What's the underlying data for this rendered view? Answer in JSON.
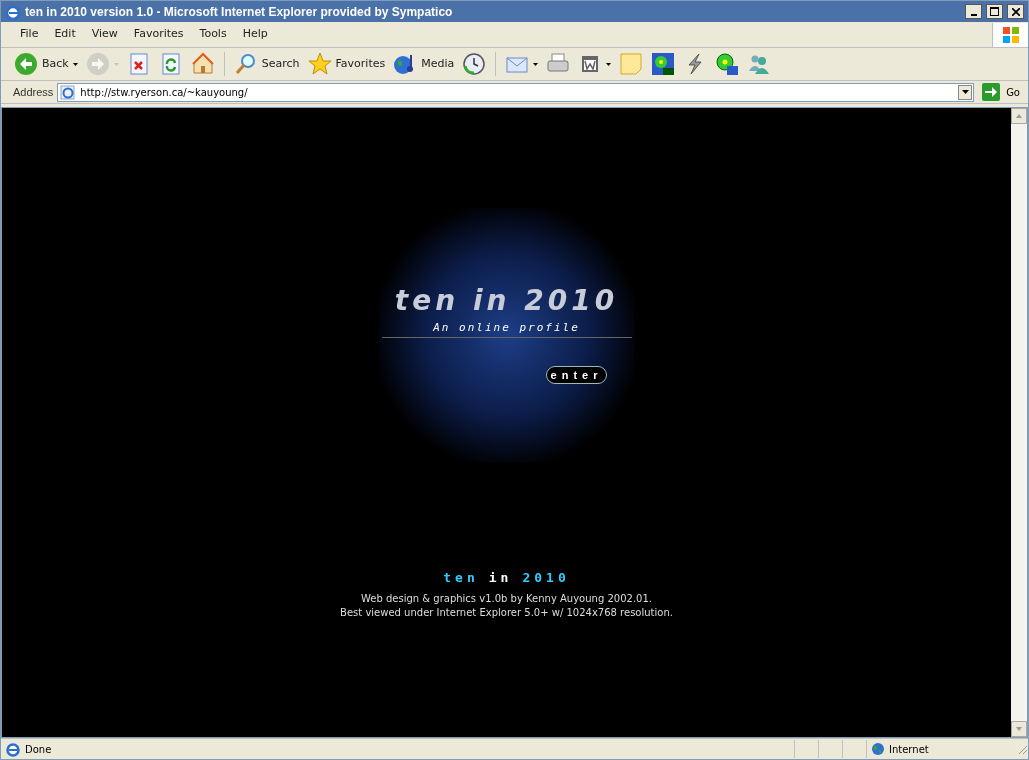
{
  "window": {
    "title": "ten in 2010 version 1.0 - Microsoft Internet Explorer provided by Sympatico"
  },
  "menu": [
    "File",
    "Edit",
    "View",
    "Favorites",
    "Tools",
    "Help"
  ],
  "toolbar": [
    {
      "kind": "back",
      "label": "Back",
      "dropdown": true,
      "disabled": false
    },
    {
      "kind": "forward",
      "dropdown": true,
      "disabled": true
    },
    {
      "kind": "stop",
      "dropdown": false,
      "disabled": false
    },
    {
      "kind": "refresh",
      "dropdown": false,
      "disabled": false
    },
    {
      "kind": "home",
      "dropdown": false,
      "disabled": false
    },
    {
      "kind": "separator"
    },
    {
      "kind": "search",
      "label": "Search",
      "dropdown": false,
      "disabled": false
    },
    {
      "kind": "favorites",
      "label": "Favorites",
      "dropdown": false,
      "disabled": false
    },
    {
      "kind": "media",
      "label": "Media",
      "dropdown": false,
      "disabled": false
    },
    {
      "kind": "history",
      "dropdown": false,
      "disabled": false
    },
    {
      "kind": "separator"
    },
    {
      "kind": "mail",
      "dropdown": true,
      "disabled": false
    },
    {
      "kind": "print",
      "dropdown": false,
      "disabled": false
    },
    {
      "kind": "edit",
      "dropdown": true,
      "disabled": false
    },
    {
      "kind": "note",
      "dropdown": false,
      "disabled": false
    },
    {
      "kind": "flower-pro",
      "dropdown": false,
      "disabled": false
    },
    {
      "kind": "lightning",
      "dropdown": false,
      "disabled": false
    },
    {
      "kind": "flower-lite",
      "dropdown": false,
      "disabled": false
    },
    {
      "kind": "people",
      "dropdown": false,
      "disabled": false
    }
  ],
  "address": {
    "label": "Address",
    "value": "http://stw.ryerson.ca/~kauyoung/",
    "go": "Go"
  },
  "splash": {
    "title": "ten in 2010",
    "subtitle": "An online profile",
    "enter": "enter"
  },
  "footer": {
    "title": [
      {
        "text": "ten",
        "color": "#33ccff"
      },
      {
        "text": "in",
        "color": "#ffffff"
      },
      {
        "text": "2010",
        "color": "#33ccff"
      }
    ],
    "lines": [
      "Web design & graphics v1.0b by Kenny Auyoung 2002.01.",
      "Best viewed under Internet Explorer 5.0+ w/ 1024x768 resolution."
    ]
  },
  "status_bar": {
    "text": "Done",
    "zone": "Internet"
  }
}
